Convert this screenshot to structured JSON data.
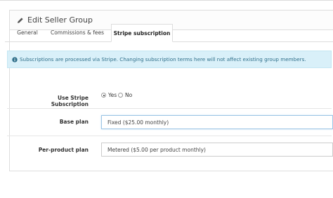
{
  "panel": {
    "title": "Edit Seller Group",
    "icon": "pencil-icon"
  },
  "tabs": [
    {
      "label": "General",
      "active": false
    },
    {
      "label": "Commissions & fees",
      "active": false
    },
    {
      "label": "Stripe subscription",
      "active": true
    }
  ],
  "alert": {
    "text": "Subscriptions are processed via Stripe. Changing subscription terms here will not affect existing group members.",
    "icon": "info-circle-icon"
  },
  "form": {
    "use_stripe": {
      "label": "Use Stripe Subscription",
      "yes": "Yes",
      "no": "No",
      "selected": "Yes"
    },
    "base_plan": {
      "label": "Base plan",
      "value": "Fixed ($25.00 monthly)"
    },
    "per_product_plan": {
      "label": "Per-product plan",
      "value": "Metered ($5.00 per product monthly)"
    }
  },
  "colors": {
    "alert_bg": "#d9f0f9",
    "alert_text": "#2f6f8a",
    "border": "#dddddd"
  }
}
